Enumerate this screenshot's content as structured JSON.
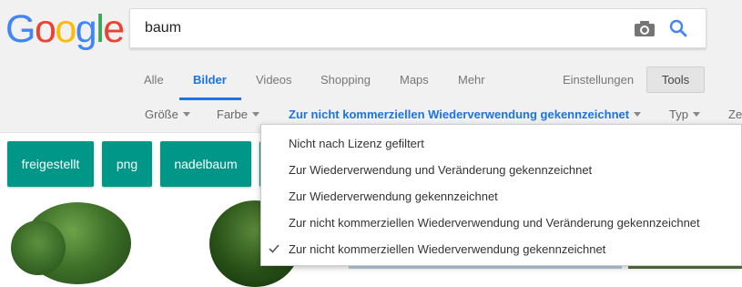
{
  "logo": {
    "letters": [
      "G",
      "o",
      "o",
      "g",
      "l",
      "e"
    ],
    "colors": [
      "#4285f4",
      "#ea4335",
      "#fbbc05",
      "#4285f4",
      "#34a853",
      "#ea4335"
    ]
  },
  "search": {
    "value": "baum",
    "camera_icon": "camera-icon",
    "search_icon": "magnifier-icon"
  },
  "tabs": [
    {
      "label": "Alle",
      "active": false
    },
    {
      "label": "Bilder",
      "active": true
    },
    {
      "label": "Videos",
      "active": false
    },
    {
      "label": "Shopping",
      "active": false
    },
    {
      "label": "Maps",
      "active": false
    },
    {
      "label": "Mehr",
      "active": false
    }
  ],
  "settings_label": "Einstellungen",
  "tools_label": "Tools",
  "filters": [
    {
      "label": "Größe",
      "selected": false
    },
    {
      "label": "Farbe",
      "selected": false
    },
    {
      "label": "Zur nicht kommerziellen Wiederverwendung gekennzeichnet",
      "selected": true
    },
    {
      "label": "Typ",
      "selected": false
    },
    {
      "label": "Ze",
      "selected": false
    }
  ],
  "chips": [
    "freigestellt",
    "png",
    "nadelbaum"
  ],
  "dropdown": {
    "items": [
      {
        "label": "Nicht nach Lizenz gefiltert",
        "checked": false
      },
      {
        "label": "Zur Wiederverwendung und Veränderung gekennzeichnet",
        "checked": false
      },
      {
        "label": "Zur Wiederverwendung gekennzeichnet",
        "checked": false
      },
      {
        "label": "Zur nicht kommerziellen Wiederverwendung und Veränderung gekennzeichnet",
        "checked": false
      },
      {
        "label": "Zur nicht kommerziellen Wiederverwendung gekennzeichnet",
        "checked": true
      }
    ]
  },
  "colors": {
    "accent": "#1a73e8",
    "chip": "#009688",
    "tree_dark": "#2e5a1f",
    "tree_light": "#4d8a33"
  }
}
